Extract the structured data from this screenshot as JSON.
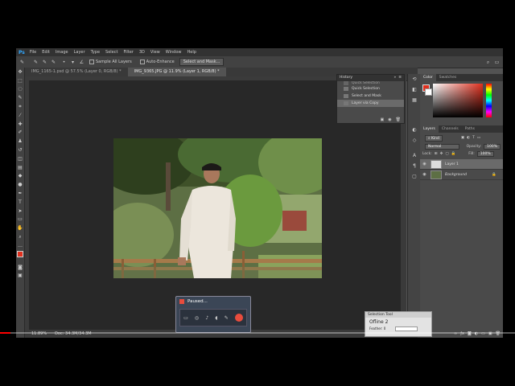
{
  "menu": {
    "logo": "Ps",
    "items": [
      "File",
      "Edit",
      "Image",
      "Layer",
      "Type",
      "Select",
      "Filter",
      "3D",
      "View",
      "Window",
      "Help"
    ]
  },
  "options": {
    "sample_all_layers": "Sample All Layers",
    "auto_enhance": "Auto-Enhance",
    "select_mask": "Select and Mask..."
  },
  "tabs": [
    {
      "label": "IMG_1165-1.psd @ 57.5% (Layer 0, RGB/8) *"
    },
    {
      "label": "IMG_9365.JPG @ 11.9% (Layer 1, RGB/8) *"
    }
  ],
  "history": {
    "title": "History",
    "items": [
      "Quick Selection",
      "Quick Selection",
      "Select and Mask",
      "Layer via Copy"
    ]
  },
  "color_panel": {
    "tab1": "Color",
    "tab2": "Swatches",
    "fg": "#e0301e",
    "bg": "#ffffff"
  },
  "layers_panel": {
    "tabs": [
      "Layers",
      "Channels",
      "Paths"
    ],
    "kind": "Kind",
    "blend": "Normal",
    "opacity_label": "Opacity:",
    "opacity": "100%",
    "lock_label": "Lock:",
    "fill_label": "Fill:",
    "fill": "100%",
    "layers": [
      {
        "name": "Layer 1",
        "selected": true
      },
      {
        "name": "Background",
        "selected": false
      }
    ]
  },
  "status": {
    "zoom": "11.89%",
    "doc": "Doc: 34.3M/34.3M"
  },
  "paused_window": {
    "title": "Paused..."
  },
  "selection_tool": {
    "title": "Selection Tool",
    "value": "Ofline 2",
    "label1": "Feather: 0"
  },
  "accent": "#31a8ff",
  "progress_fraction": 0.02
}
